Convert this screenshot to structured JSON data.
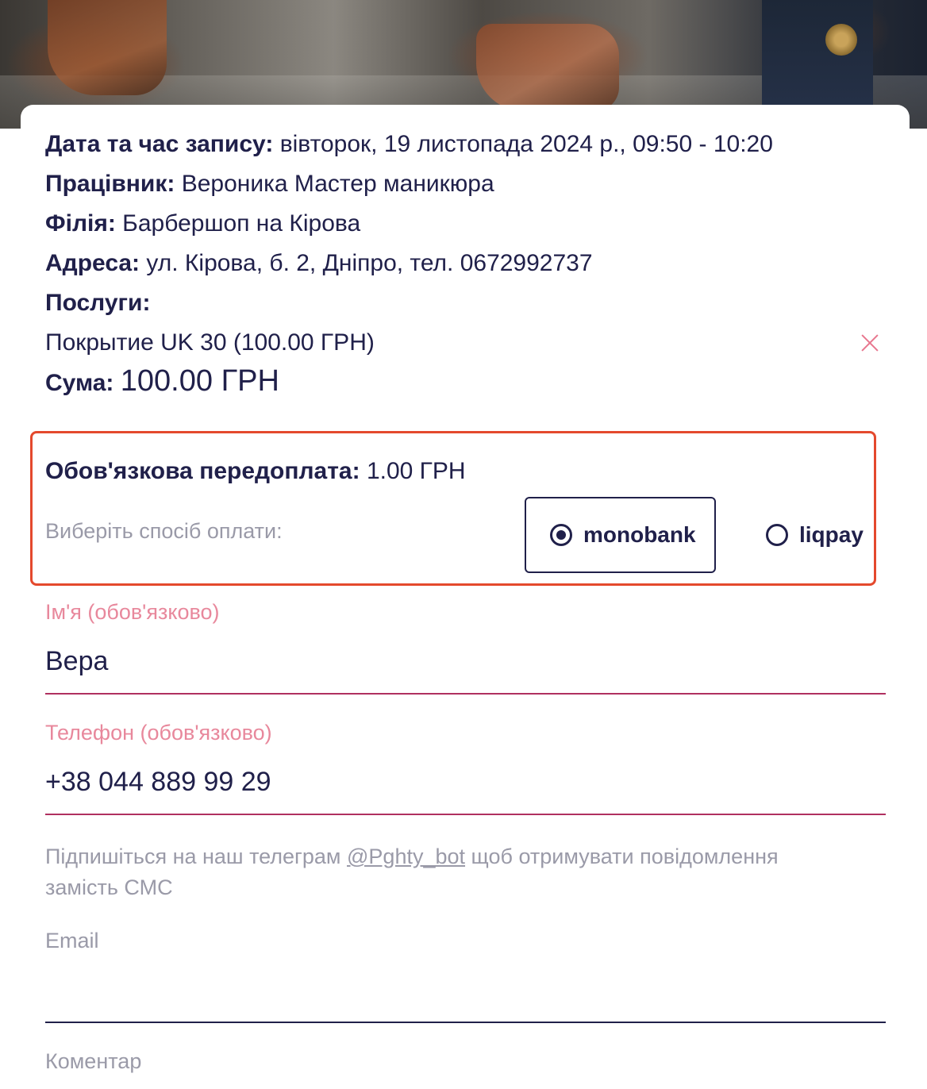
{
  "booking": {
    "datetime_label": "Дата та час запису:",
    "datetime_value": "вівторок, 19 листопада 2024 р., 09:50 - 10:20",
    "employee_label": "Працівник:",
    "employee_value": "Вероника Мастер маникюра",
    "branch_label": "Філія:",
    "branch_value": "Барбершоп на Кірова",
    "address_label": "Адреса:",
    "address_value": "ул. Кірова, б. 2, Дніпро, тел. 0672992737",
    "services_label": "Послуги:",
    "services": [
      {
        "name": "Покрытие UK 30 (100.00 ГРН)"
      }
    ],
    "sum_label": "Сума:",
    "sum_value": "100.00 ГРН"
  },
  "prepayment": {
    "label": "Обов'язкова передоплата:",
    "value": "1.00 ГРН",
    "method_hint": "Виберіть спосіб оплати:",
    "methods": [
      {
        "label": "monobank",
        "selected": true
      },
      {
        "label": "liqpay",
        "selected": false
      }
    ],
    "highlight_color": "#e4492d"
  },
  "form": {
    "name_label": "Ім'я (обов'язково)",
    "name_value": "Вера",
    "phone_label": "Телефон (обов'язково)",
    "phone_value": "+38 044 889 99 29",
    "telegram_prefix": "Підпишіться на наш телеграм",
    "telegram_handle": "@Pghty_bot",
    "telegram_suffix": "щоб отримувати повідомлення замість СМС",
    "email_label": "Email",
    "email_value": "",
    "comment_label": "Коментар"
  },
  "colors": {
    "text_primary": "#20204a",
    "required_label": "#e8889c",
    "required_underline": "#b03060",
    "muted": "#9a9aa8"
  }
}
